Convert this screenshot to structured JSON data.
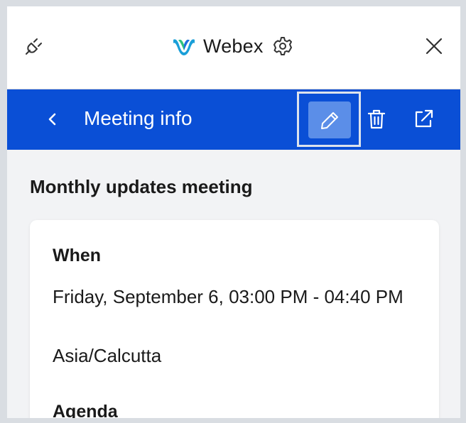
{
  "header": {
    "app_name": "Webex",
    "icons": [
      "plug-icon",
      "webex-logo",
      "gear-icon",
      "close-icon"
    ]
  },
  "toolbar": {
    "title": "Meeting info",
    "icons": [
      "back-chevron-icon",
      "pencil-icon",
      "trash-icon",
      "external-link-icon"
    ],
    "colors": {
      "bar": "#0a4fd6",
      "edit_button": "#5b8ee8"
    }
  },
  "meeting": {
    "name": "Monthly updates meeting",
    "when_label": "When",
    "when_text": "Friday, September 6, 03:00 PM - 04:40 PM",
    "timezone": "Asia/Calcutta",
    "agenda_label": "Agenda"
  }
}
